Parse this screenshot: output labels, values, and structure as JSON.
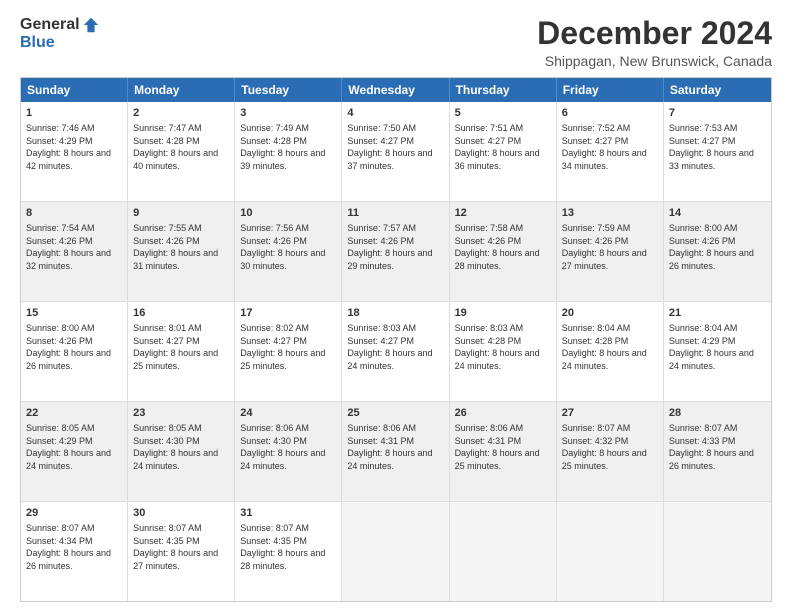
{
  "logo": {
    "general": "General",
    "blue": "Blue"
  },
  "header": {
    "title": "December 2024",
    "subtitle": "Shippagan, New Brunswick, Canada"
  },
  "calendar": {
    "days": [
      "Sunday",
      "Monday",
      "Tuesday",
      "Wednesday",
      "Thursday",
      "Friday",
      "Saturday"
    ],
    "rows": [
      [
        {
          "day": "1",
          "sunrise": "Sunrise: 7:46 AM",
          "sunset": "Sunset: 4:29 PM",
          "daylight": "Daylight: 8 hours and 42 minutes.",
          "empty": false
        },
        {
          "day": "2",
          "sunrise": "Sunrise: 7:47 AM",
          "sunset": "Sunset: 4:28 PM",
          "daylight": "Daylight: 8 hours and 40 minutes.",
          "empty": false
        },
        {
          "day": "3",
          "sunrise": "Sunrise: 7:49 AM",
          "sunset": "Sunset: 4:28 PM",
          "daylight": "Daylight: 8 hours and 39 minutes.",
          "empty": false
        },
        {
          "day": "4",
          "sunrise": "Sunrise: 7:50 AM",
          "sunset": "Sunset: 4:27 PM",
          "daylight": "Daylight: 8 hours and 37 minutes.",
          "empty": false
        },
        {
          "day": "5",
          "sunrise": "Sunrise: 7:51 AM",
          "sunset": "Sunset: 4:27 PM",
          "daylight": "Daylight: 8 hours and 36 minutes.",
          "empty": false
        },
        {
          "day": "6",
          "sunrise": "Sunrise: 7:52 AM",
          "sunset": "Sunset: 4:27 PM",
          "daylight": "Daylight: 8 hours and 34 minutes.",
          "empty": false
        },
        {
          "day": "7",
          "sunrise": "Sunrise: 7:53 AM",
          "sunset": "Sunset: 4:27 PM",
          "daylight": "Daylight: 8 hours and 33 minutes.",
          "empty": false
        }
      ],
      [
        {
          "day": "8",
          "sunrise": "Sunrise: 7:54 AM",
          "sunset": "Sunset: 4:26 PM",
          "daylight": "Daylight: 8 hours and 32 minutes.",
          "empty": false
        },
        {
          "day": "9",
          "sunrise": "Sunrise: 7:55 AM",
          "sunset": "Sunset: 4:26 PM",
          "daylight": "Daylight: 8 hours and 31 minutes.",
          "empty": false
        },
        {
          "day": "10",
          "sunrise": "Sunrise: 7:56 AM",
          "sunset": "Sunset: 4:26 PM",
          "daylight": "Daylight: 8 hours and 30 minutes.",
          "empty": false
        },
        {
          "day": "11",
          "sunrise": "Sunrise: 7:57 AM",
          "sunset": "Sunset: 4:26 PM",
          "daylight": "Daylight: 8 hours and 29 minutes.",
          "empty": false
        },
        {
          "day": "12",
          "sunrise": "Sunrise: 7:58 AM",
          "sunset": "Sunset: 4:26 PM",
          "daylight": "Daylight: 8 hours and 28 minutes.",
          "empty": false
        },
        {
          "day": "13",
          "sunrise": "Sunrise: 7:59 AM",
          "sunset": "Sunset: 4:26 PM",
          "daylight": "Daylight: 8 hours and 27 minutes.",
          "empty": false
        },
        {
          "day": "14",
          "sunrise": "Sunrise: 8:00 AM",
          "sunset": "Sunset: 4:26 PM",
          "daylight": "Daylight: 8 hours and 26 minutes.",
          "empty": false
        }
      ],
      [
        {
          "day": "15",
          "sunrise": "Sunrise: 8:00 AM",
          "sunset": "Sunset: 4:26 PM",
          "daylight": "Daylight: 8 hours and 26 minutes.",
          "empty": false
        },
        {
          "day": "16",
          "sunrise": "Sunrise: 8:01 AM",
          "sunset": "Sunset: 4:27 PM",
          "daylight": "Daylight: 8 hours and 25 minutes.",
          "empty": false
        },
        {
          "day": "17",
          "sunrise": "Sunrise: 8:02 AM",
          "sunset": "Sunset: 4:27 PM",
          "daylight": "Daylight: 8 hours and 25 minutes.",
          "empty": false
        },
        {
          "day": "18",
          "sunrise": "Sunrise: 8:03 AM",
          "sunset": "Sunset: 4:27 PM",
          "daylight": "Daylight: 8 hours and 24 minutes.",
          "empty": false
        },
        {
          "day": "19",
          "sunrise": "Sunrise: 8:03 AM",
          "sunset": "Sunset: 4:28 PM",
          "daylight": "Daylight: 8 hours and 24 minutes.",
          "empty": false
        },
        {
          "day": "20",
          "sunrise": "Sunrise: 8:04 AM",
          "sunset": "Sunset: 4:28 PM",
          "daylight": "Daylight: 8 hours and 24 minutes.",
          "empty": false
        },
        {
          "day": "21",
          "sunrise": "Sunrise: 8:04 AM",
          "sunset": "Sunset: 4:29 PM",
          "daylight": "Daylight: 8 hours and 24 minutes.",
          "empty": false
        }
      ],
      [
        {
          "day": "22",
          "sunrise": "Sunrise: 8:05 AM",
          "sunset": "Sunset: 4:29 PM",
          "daylight": "Daylight: 8 hours and 24 minutes.",
          "empty": false
        },
        {
          "day": "23",
          "sunrise": "Sunrise: 8:05 AM",
          "sunset": "Sunset: 4:30 PM",
          "daylight": "Daylight: 8 hours and 24 minutes.",
          "empty": false
        },
        {
          "day": "24",
          "sunrise": "Sunrise: 8:06 AM",
          "sunset": "Sunset: 4:30 PM",
          "daylight": "Daylight: 8 hours and 24 minutes.",
          "empty": false
        },
        {
          "day": "25",
          "sunrise": "Sunrise: 8:06 AM",
          "sunset": "Sunset: 4:31 PM",
          "daylight": "Daylight: 8 hours and 24 minutes.",
          "empty": false
        },
        {
          "day": "26",
          "sunrise": "Sunrise: 8:06 AM",
          "sunset": "Sunset: 4:31 PM",
          "daylight": "Daylight: 8 hours and 25 minutes.",
          "empty": false
        },
        {
          "day": "27",
          "sunrise": "Sunrise: 8:07 AM",
          "sunset": "Sunset: 4:32 PM",
          "daylight": "Daylight: 8 hours and 25 minutes.",
          "empty": false
        },
        {
          "day": "28",
          "sunrise": "Sunrise: 8:07 AM",
          "sunset": "Sunset: 4:33 PM",
          "daylight": "Daylight: 8 hours and 26 minutes.",
          "empty": false
        }
      ],
      [
        {
          "day": "29",
          "sunrise": "Sunrise: 8:07 AM",
          "sunset": "Sunset: 4:34 PM",
          "daylight": "Daylight: 8 hours and 26 minutes.",
          "empty": false
        },
        {
          "day": "30",
          "sunrise": "Sunrise: 8:07 AM",
          "sunset": "Sunset: 4:35 PM",
          "daylight": "Daylight: 8 hours and 27 minutes.",
          "empty": false
        },
        {
          "day": "31",
          "sunrise": "Sunrise: 8:07 AM",
          "sunset": "Sunset: 4:35 PM",
          "daylight": "Daylight: 8 hours and 28 minutes.",
          "empty": false
        },
        {
          "day": "",
          "sunrise": "",
          "sunset": "",
          "daylight": "",
          "empty": true
        },
        {
          "day": "",
          "sunrise": "",
          "sunset": "",
          "daylight": "",
          "empty": true
        },
        {
          "day": "",
          "sunrise": "",
          "sunset": "",
          "daylight": "",
          "empty": true
        },
        {
          "day": "",
          "sunrise": "",
          "sunset": "",
          "daylight": "",
          "empty": true
        }
      ]
    ]
  }
}
